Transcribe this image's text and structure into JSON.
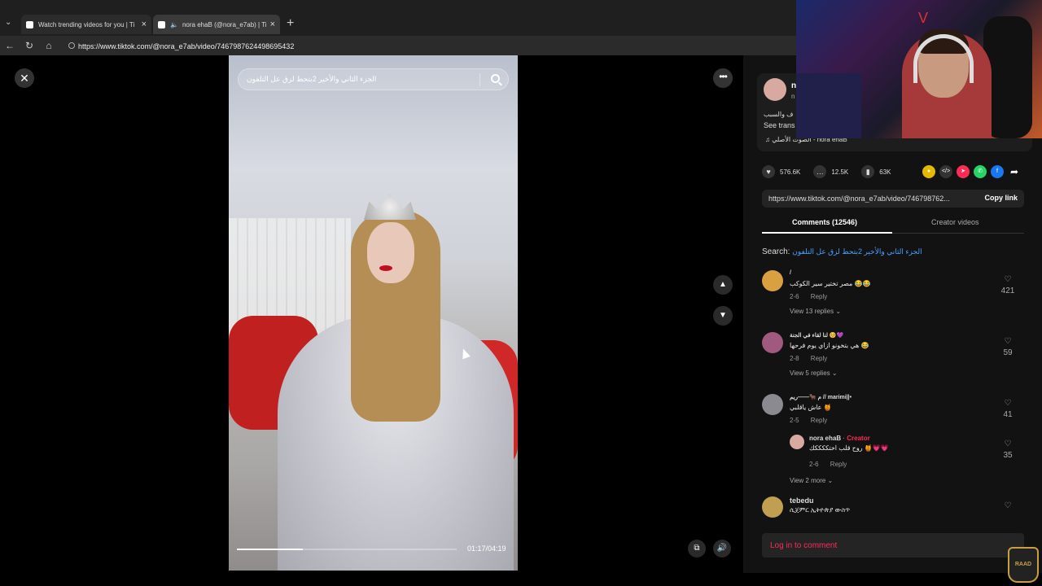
{
  "browser": {
    "tabs": [
      {
        "title": "Watch trending videos for you | Ti"
      },
      {
        "title": "nora ehaB (@nora_e7ab) | Ti"
      }
    ],
    "url": "https://www.tiktok.com/@nora_e7ab/video/7467987624498695432"
  },
  "video": {
    "search_text": "الجزء الثاني والأخير 2بتحط لزق عل التلفون",
    "time": "01:17/04:19",
    "progress": 0.3
  },
  "author": {
    "name": "n",
    "handle": "n",
    "desc": "ف والسبب",
    "see_translation": "See trans",
    "music": "الصوت الأصلي - nora ehaB"
  },
  "actions": {
    "likes": "576.6K",
    "comments": "12.5K",
    "saves": "63K"
  },
  "link": {
    "url": "https://www.tiktok.com/@nora_e7ab/video/746798762...",
    "copy_label": "Copy link"
  },
  "panel_tabs": {
    "comments": "Comments (12546)",
    "creator": "Creator videos"
  },
  "search": {
    "label": "Search:",
    "query": "الجزء الثاني والأخير 2بتحط لزق عل التلفون"
  },
  "comments": [
    {
      "name": "/",
      "text": "مصر تختير سير الكوكب 😂😂",
      "date": "2-6",
      "reply": "Reply",
      "view": "View 13 replies",
      "likes": "421"
    },
    {
      "name": "لنا لقاء في الجنة 🥺💜",
      "text": "هي بتخونو ازاي يوم فرحها 😂",
      "date": "2-8",
      "reply": "Reply",
      "view": "View 5 replies",
      "likes": "59"
    },
    {
      "name": "م 🐂——ريم // marimi||•",
      "text": "عاش ياقلبي 🍯",
      "date": "2-5",
      "reply": "Reply",
      "view": "View 2 more",
      "likes": "41"
    },
    {
      "name": "tebedu",
      "text": "ሲጀምር ኢትዮጵያ ውስጥ",
      "date": "",
      "reply": "",
      "view": "",
      "likes": ""
    }
  ],
  "reply_item": {
    "name": "nora ehaB",
    "creator_tag": "· Creator",
    "text": "روح قلب اختككككك 🍯💗💗",
    "date": "2-6",
    "reply": "Reply",
    "likes": "35"
  },
  "login_label": "Log in to comment",
  "watermark": "RAAD"
}
